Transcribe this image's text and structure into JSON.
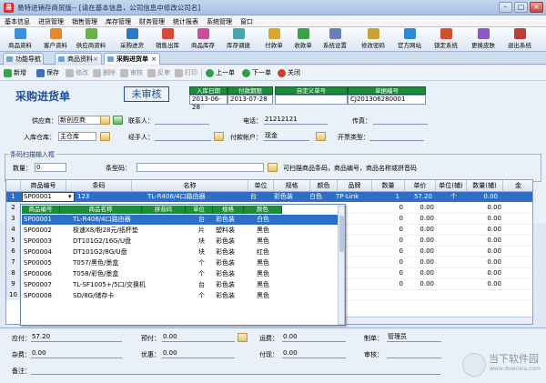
{
  "window": {
    "title": "易特进销存商贸版-- [请在基本信息，公司信息中修改公司名]",
    "minimize": "–",
    "maximize": "□",
    "close": "×"
  },
  "menu": [
    "基本信息",
    "进货管理",
    "销售管理",
    "库存管理",
    "财务管理",
    "统计报表",
    "系统管理",
    "窗口"
  ],
  "toolbar": [
    {
      "label": "商品资料",
      "color": "#3d8fd8"
    },
    {
      "label": "客户资料",
      "color": "#e08a2c"
    },
    {
      "label": "供应商资料",
      "color": "#6bb04a"
    },
    {
      "label": "采购进货",
      "color": "#2b79c6"
    },
    {
      "label": "销售出库",
      "color": "#d64a3a"
    },
    {
      "label": "商品库存",
      "color": "#c94f9c"
    },
    {
      "label": "库存调拨",
      "color": "#4aa5a8"
    },
    {
      "label": "付款单",
      "color": "#d8a72c"
    },
    {
      "label": "收款单",
      "color": "#3aa14a"
    },
    {
      "label": "系统设置",
      "color": "#6a7fb8"
    },
    {
      "label": "修改密码",
      "color": "#c9a23a"
    },
    {
      "label": "官方网站",
      "color": "#2f89d0"
    },
    {
      "label": "锁定系统",
      "color": "#d0502d"
    },
    {
      "label": "更换皮肤",
      "color": "#8a5ac2"
    },
    {
      "label": "退出系统",
      "color": "#c23b34"
    }
  ],
  "tabs": [
    {
      "label": "功能导航"
    },
    {
      "label": "商品资料"
    },
    {
      "label": "采购进货单"
    }
  ],
  "actions": {
    "new": "新增",
    "save": "保存",
    "modify": "修改",
    "delete": "删除",
    "audit": "审核",
    "unaudit": "反审",
    "print": "打印",
    "prev": "上一单",
    "next": "下一单",
    "close": "关闭"
  },
  "form": {
    "title": "采购进货单",
    "status": "未审核",
    "headers": [
      "入库日期",
      "付款期限",
      "自定义单号",
      "单据编号"
    ],
    "values": [
      "2013-06-28",
      "2013-07-28",
      "",
      "CJ201306280001"
    ],
    "supplier_label": "供应商：",
    "supplier": "新创应商",
    "contact_label": "联系人：",
    "contact": "",
    "phone_label": "电话：",
    "phone": "21212121",
    "fax_label": "传真：",
    "fax": "",
    "warehouse_label": "入库仓库：",
    "warehouse": "主仓库",
    "handler_label": "经手人：",
    "handler": "",
    "account_label": "付款帐户：",
    "account": "现金",
    "invoice_label": "开票类型：",
    "invoice": ""
  },
  "scan": {
    "legend": "条码扫描输入框",
    "qty_label": "数量：",
    "qty": "0",
    "barcode_label": "条型码：",
    "barcode": "",
    "hint": "可扫描商品条码，商品编号，商品名称或拼音码"
  },
  "grid": {
    "columns": [
      "商品编号",
      "条码",
      "名称",
      "单位",
      "规格",
      "颜色",
      "品牌",
      "数量",
      "单价",
      "单位(辅)",
      "数量(辅)",
      "金"
    ],
    "row1": {
      "num": "1",
      "code": "SP00001",
      "barcode": "123",
      "name": "TL-R406/4口路由器",
      "unit": "台",
      "spec": "彩色装",
      "color": "白色",
      "brand": "TP-Link",
      "qty": "1",
      "price": "57.20",
      "unit2": "个",
      "qty2": "0.00"
    },
    "row_numbers": [
      "2",
      "3",
      "4",
      "5",
      "6",
      "7",
      "8",
      "9",
      "10"
    ],
    "right_values": [
      [
        "0",
        "0.00",
        "0.00"
      ],
      [
        "0",
        "0.00",
        "0.00"
      ],
      [
        "0",
        "0.00",
        "0.00"
      ],
      [
        "0",
        "0.00",
        "0.00"
      ],
      [
        "0",
        "0.00",
        "0.00"
      ],
      [
        "0",
        "0.00",
        "0.00"
      ],
      [
        "0",
        "0.00",
        "0.00"
      ],
      [
        "0",
        "0.00",
        "0.00"
      ]
    ]
  },
  "dropdown": {
    "columns": [
      "商品编号",
      "商品名称",
      "拼音码",
      "单位",
      "规格",
      "颜色"
    ],
    "rows": [
      {
        "code": "SP00001",
        "name": "TL-R406/4口路由器",
        "py": "",
        "unit": "台",
        "spec": "彩色装",
        "color": "白色"
      },
      {
        "code": "SP00002",
        "name": "极速X8/粉28元/纸杯垫",
        "py": "",
        "unit": "片",
        "spec": "塑料装",
        "color": "黑色"
      },
      {
        "code": "SP00003",
        "name": "DT101G2/16G/U盘",
        "py": "",
        "unit": "块",
        "spec": "彩色装",
        "color": "黑色"
      },
      {
        "code": "SP00004",
        "name": "DT101G2/8G/U盘",
        "py": "",
        "unit": "块",
        "spec": "彩色装",
        "color": "红色"
      },
      {
        "code": "SP00005",
        "name": "T057/黑色/墨盒",
        "py": "",
        "unit": "个",
        "spec": "彩色装",
        "color": "黑色"
      },
      {
        "code": "SP00006",
        "name": "T058/彩色/墨盒",
        "py": "",
        "unit": "个",
        "spec": "彩色装",
        "color": "黑色"
      },
      {
        "code": "SP00007",
        "name": "TL-SF1005+/5口/交换机",
        "py": "",
        "unit": "台",
        "spec": "彩色装",
        "color": "黑色"
      },
      {
        "code": "SP00008",
        "name": "SD/8G/储存卡",
        "py": "",
        "unit": "个",
        "spec": "彩色装",
        "color": "黑色"
      }
    ]
  },
  "footer": {
    "payable_label": "应付：",
    "payable": "57.20",
    "prepaid_label": "预付：",
    "prepaid": "0.00",
    "freight_label": "运费：",
    "freight": "0.00",
    "maker_label": "制单：",
    "maker": "管理员",
    "misc_label": "杂费：",
    "misc": "0.00",
    "discount_label": "优惠：",
    "discount": "0.00",
    "paid_label": "付现：",
    "paid": "0.00",
    "auditor_label": "审核：",
    "auditor": "",
    "note_label": "备注：",
    "note": ""
  },
  "watermark": {
    "line1": "当下软件园",
    "line2": "www.downxia.com"
  }
}
